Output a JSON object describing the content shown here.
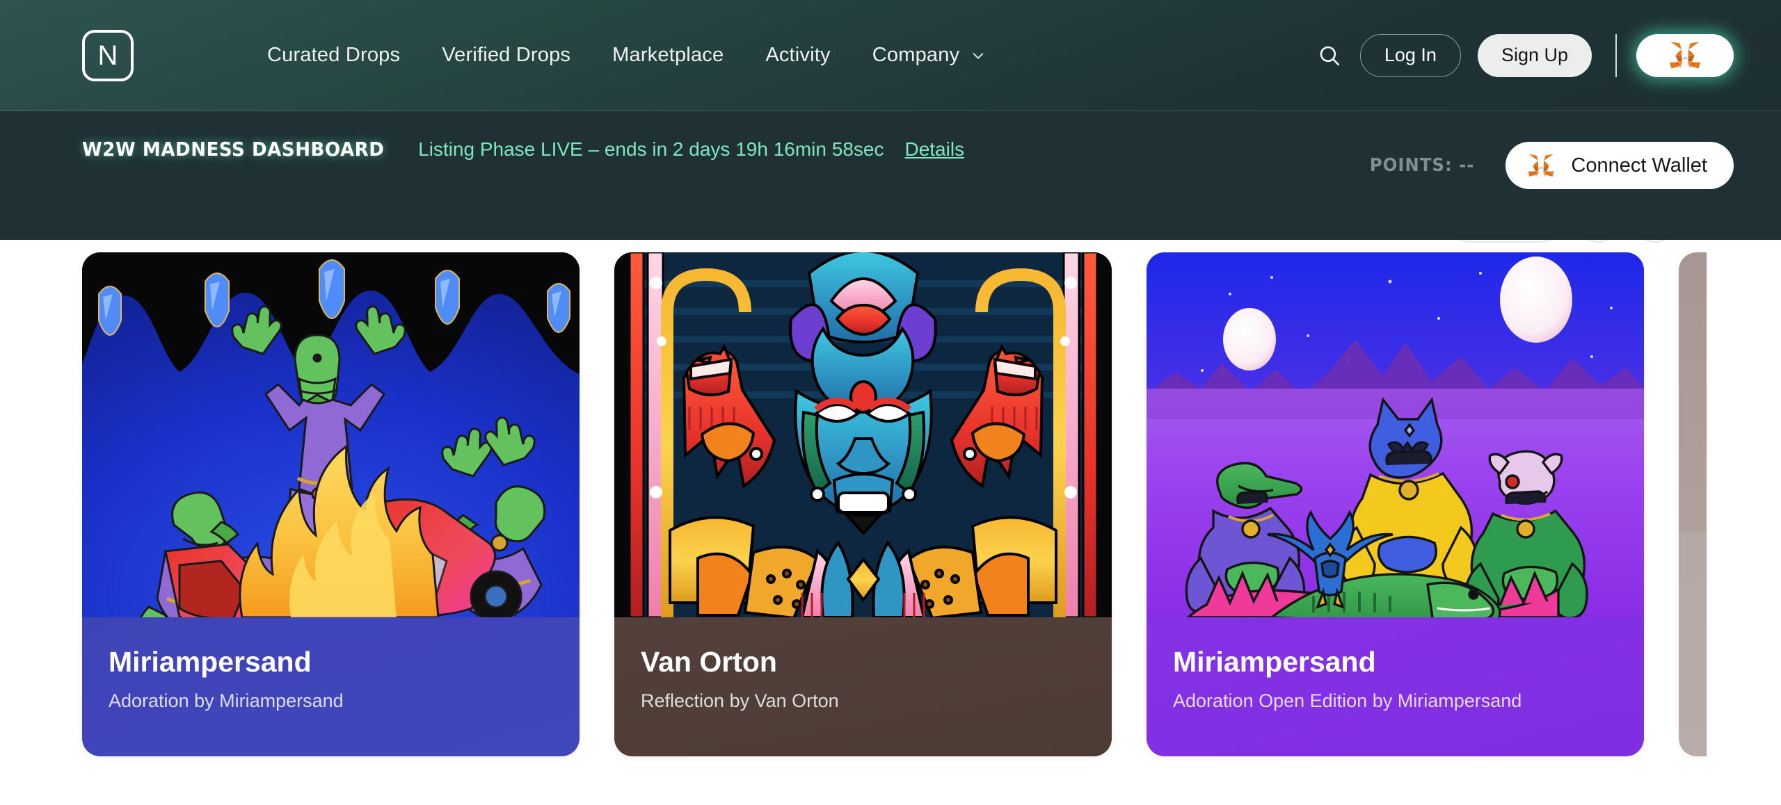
{
  "nav": {
    "logo_letter": "N",
    "links": [
      {
        "label": "Curated Drops",
        "dropdown": false
      },
      {
        "label": "Verified Drops",
        "dropdown": false
      },
      {
        "label": "Marketplace",
        "dropdown": false
      },
      {
        "label": "Activity",
        "dropdown": false
      },
      {
        "label": "Company",
        "dropdown": true
      }
    ],
    "search_icon": "search-icon",
    "login_label": "Log In",
    "signup_label": "Sign Up",
    "wallet_icon": "metamask-fox-icon"
  },
  "banner": {
    "title": "W2W MADNESS DASHBOARD",
    "status": "Listing Phase LIVE – ends in 2 days 19h 16min 58sec",
    "details_label": "Details",
    "points_label": "POINTS:",
    "points_value": "--",
    "connect_wallet_label": "Connect Wallet",
    "connect_wallet_icon": "metamask-fox-icon",
    "colors": {
      "accent_green": "#7fe6c0",
      "banner_bg": "#1f3134",
      "nav_bg": "#264642"
    }
  },
  "cards": [
    {
      "artist": "Miriampersand",
      "subtitle": "Adoration by Miriampersand",
      "accent": "#3f43b4",
      "art": "crocodile-cultists-burning-car"
    },
    {
      "artist": "Van Orton",
      "subtitle": "Reflection by Van Orton",
      "accent": "#53403a",
      "art": "stained-glass-symmetric-face"
    },
    {
      "artist": "Miriampersand",
      "subtitle": "Adoration Open Edition by Miriampersand",
      "accent": "#8531e6",
      "art": "meditating-animals-two-moons"
    }
  ]
}
